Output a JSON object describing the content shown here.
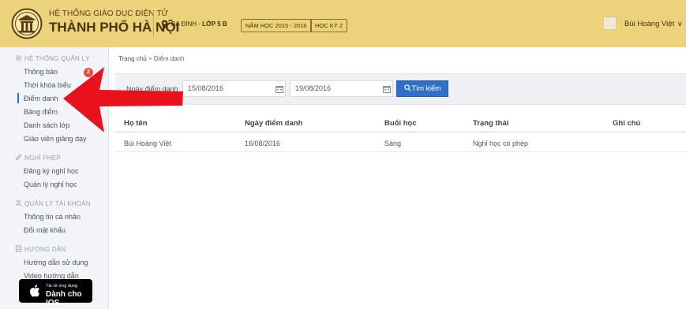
{
  "header": {
    "brand_top": "HỆ THỐNG GIÁO DỤC ĐIỆN TỬ",
    "brand_main": "THÀNH PHỐ HÀ NỘI",
    "location_area": "BA ĐÌNH - ",
    "location_class": "LỚP 5 B",
    "school_year": "NĂM HỌC 2015 - 2016",
    "semester": "HỌC KỲ 2",
    "user_name": "Bùi Hoàng Việt",
    "user_caret": "∨"
  },
  "sidebar": {
    "sections": [
      {
        "title": "HỆ THỐNG QUẢN LÝ",
        "icon": "gear-icon",
        "items": [
          "Thông báo",
          "Thời khóa biểu",
          "Điểm danh",
          "Bảng điểm",
          "Danh sách lớp",
          "Giáo viên giảng dạy"
        ]
      },
      {
        "title": "NGHỈ PHÉP",
        "icon": "pencil-icon",
        "items": [
          "Đăng ký nghỉ học",
          "Quản lý nghỉ học"
        ]
      },
      {
        "title": "QUẢN LÝ TÀI KHOẢN",
        "icon": "user-icon",
        "items": [
          "Thông tin cá nhân",
          "Đổi mật khẩu"
        ]
      },
      {
        "title": "HƯỚNG DẪN",
        "icon": "document-icon",
        "items": [
          "Hướng dẫn sử dụng",
          "Video hướng dẫn"
        ]
      }
    ],
    "active_item": "Điểm danh",
    "notification_count": "2",
    "store_badge": {
      "small": "Tải về ứng dụng",
      "big": "Dành cho IOS"
    }
  },
  "breadcrumb": {
    "home": "Trang chủ",
    "separator": " > ",
    "current": "Điểm danh"
  },
  "filter": {
    "label": "Ngày điểm danh",
    "from_date": "15/08/2016",
    "to_date": "19/08/2016",
    "search_label": "Tìm kiếm"
  },
  "table": {
    "headers": [
      "Họ tên",
      "Ngày điểm danh",
      "Buổi học",
      "Trạng thái",
      "Ghi chú"
    ],
    "rows": [
      [
        "Bùi Hoàng Việt",
        "16/08/2016",
        "Sáng",
        "Nghỉ học có phép",
        ""
      ]
    ]
  },
  "colors": {
    "header_bg": "#ecd27a",
    "accent_blue": "#2f6fc9",
    "arrow_red": "#e8121c",
    "badge_red": "#e64b3c"
  }
}
